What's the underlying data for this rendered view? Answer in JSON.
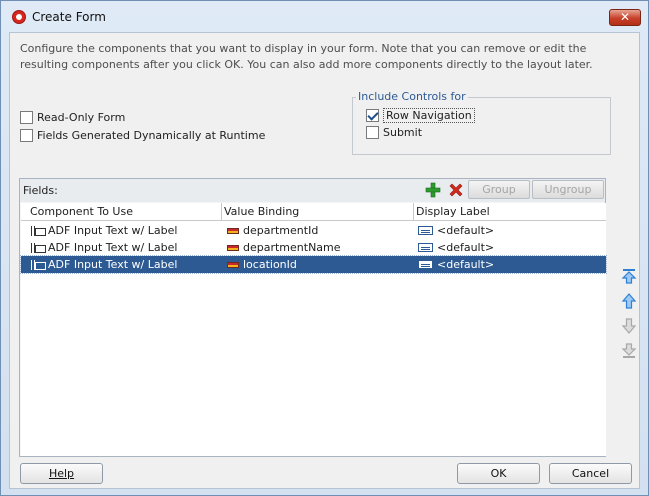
{
  "window": {
    "title": "Create Form",
    "close_label": "✕"
  },
  "description": "Configure the components that you want to display in your form. Note that you can remove or edit the resulting components after you click OK. You can also add more components directly to the layout later.",
  "options": {
    "read_only": {
      "label": "Read-Only Form",
      "checked": false
    },
    "dynamic": {
      "label": "Fields Generated Dynamically at Runtime",
      "checked": false
    }
  },
  "include_controls": {
    "legend": "Include Controls for",
    "row_navigation": {
      "label": "Row Navigation",
      "checked": true
    },
    "submit": {
      "label": "Submit",
      "checked": false
    }
  },
  "fields": {
    "label": "Fields:",
    "group_label": "Group",
    "ungroup_label": "Ungroup",
    "columns": [
      "Component To Use",
      "Value Binding",
      "Display Label"
    ],
    "rows": [
      {
        "component": "ADF Input Text w/ Label",
        "binding": "departmentId",
        "display": "<default>",
        "selected": false
      },
      {
        "component": "ADF Input Text w/ Label",
        "binding": "departmentName",
        "display": "<default>",
        "selected": false
      },
      {
        "component": "ADF Input Text w/ Label",
        "binding": "locationId",
        "display": "<default>",
        "selected": true
      }
    ]
  },
  "colors": {
    "selection": "#2d5a93",
    "add": "#2e9b2e",
    "remove": "#d42a1e",
    "arrow_active": "#2f7fd3",
    "arrow_disabled": "#a8a8a8"
  },
  "buttons": {
    "help": "Help",
    "ok": "OK",
    "cancel": "Cancel"
  }
}
